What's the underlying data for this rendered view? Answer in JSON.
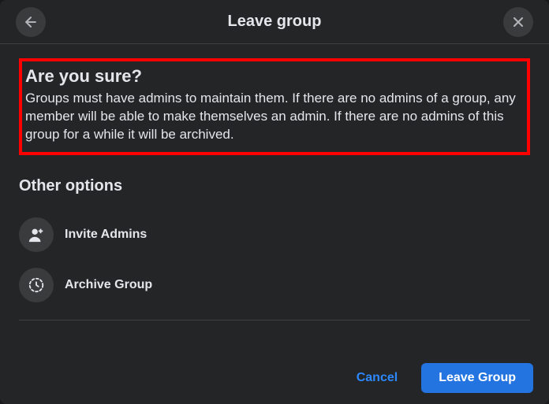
{
  "header": {
    "title": "Leave group"
  },
  "alert": {
    "heading": "Are you sure?",
    "body": "Groups must have admins to maintain them. If there are no admins of a group, any member will be able to make themselves an admin. If there are no admins of this group for a while it will be archived."
  },
  "otherOptions": {
    "heading": "Other options",
    "items": [
      {
        "label": "Invite Admins"
      },
      {
        "label": "Archive Group"
      }
    ]
  },
  "footer": {
    "cancel": "Cancel",
    "leave": "Leave Group"
  }
}
